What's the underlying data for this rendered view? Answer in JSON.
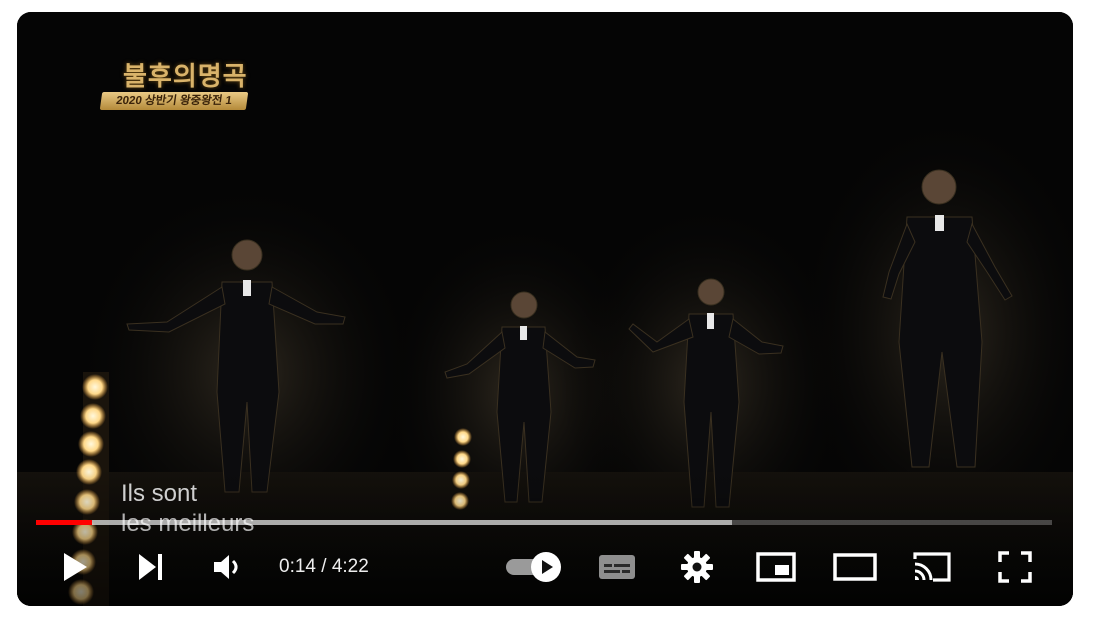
{
  "logo": {
    "title": "불후의명곡",
    "subtitle": "2020 상반기 왕중왕전 1"
  },
  "subtitle": {
    "line1": "Ils sont",
    "line2": "les meilleurs"
  },
  "progress": {
    "played_fraction": 0.055,
    "loaded_fraction": 0.685
  },
  "time": {
    "current": "0:14",
    "separator": " / ",
    "duration": "4:22"
  },
  "controls": {
    "play": "play-icon",
    "next": "next-icon",
    "volume": "volume-icon",
    "autoplay": "autoplay-toggle",
    "captions": "captions-icon",
    "settings": "gear-icon",
    "miniplayer": "miniplayer-icon",
    "theater": "theater-icon",
    "cast": "cast-icon",
    "fullscreen": "fullscreen-icon"
  },
  "colors": {
    "accent": "#ff0000",
    "gold": "#d9b36a"
  }
}
